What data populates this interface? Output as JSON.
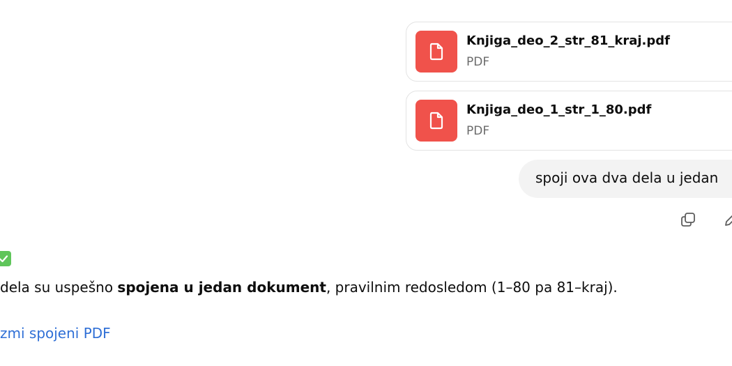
{
  "conversation": {
    "attachments": [
      {
        "name": "Knjiga_deo_2_str_81_kraj.pdf",
        "type": "PDF",
        "icon": "document-icon",
        "icon_color": "#f0524b"
      },
      {
        "name": "Knjiga_deo_1_str_1_80.pdf",
        "type": "PDF",
        "icon": "document-icon",
        "icon_color": "#f0524b"
      }
    ],
    "user_message": "spoji ova dva dela u jedan",
    "message_actions": [
      "copy-icon",
      "edit-icon"
    ],
    "assistant": {
      "status_emoji": "check-mark-icon",
      "text_before": "dela su uspešno ",
      "text_bold": "spojena u jedan dokument",
      "text_after": ", pravilnim redosledom (1–80 pa 81–kraj).",
      "download_link": "zmi spojeni PDF"
    }
  },
  "colors": {
    "file_icon_bg": "#f0524b",
    "link": "#2f6fd6",
    "bubble_bg": "#f3f3f3",
    "check_bg": "#5fc55a"
  }
}
